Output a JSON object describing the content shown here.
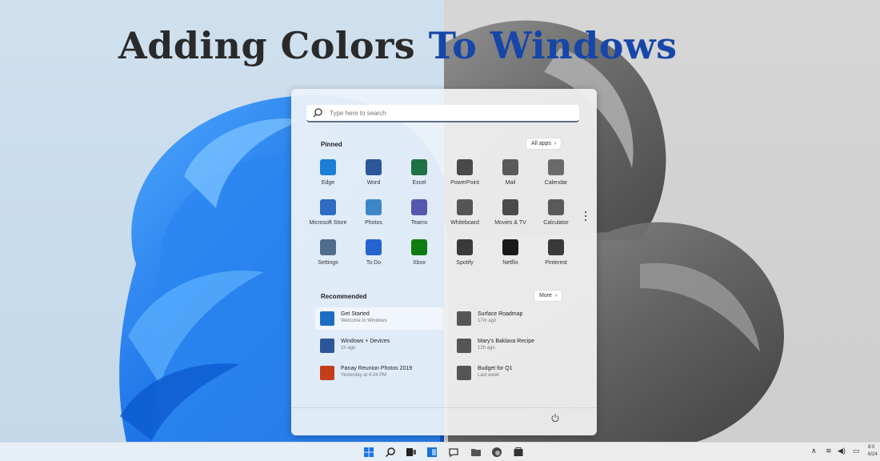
{
  "headline": {
    "part1": "Adding Colors",
    "part2": "To Windows"
  },
  "search": {
    "placeholder": "Type here to search"
  },
  "pinned": {
    "title": "Pinned",
    "all_apps_label": "All apps",
    "apps": [
      {
        "label": "Edge",
        "icon": "edge-icon",
        "color": "#1b7fd6"
      },
      {
        "label": "Word",
        "icon": "word-icon",
        "color": "#2b579a"
      },
      {
        "label": "Excel",
        "icon": "excel-icon",
        "color": "#1f7244"
      },
      {
        "label": "PowerPoint",
        "icon": "powerpoint-icon",
        "color": "#4a4a4a"
      },
      {
        "label": "Mail",
        "icon": "mail-icon",
        "color": "#5a5a5a"
      },
      {
        "label": "Calendar",
        "icon": "calendar-icon",
        "color": "#6a6a6a"
      },
      {
        "label": "Microsoft Store",
        "icon": "store-icon",
        "color": "#2d6cc0"
      },
      {
        "label": "Photos",
        "icon": "photos-icon",
        "color": "#3d87c7"
      },
      {
        "label": "Teams",
        "icon": "teams-icon",
        "color": "#5558af"
      },
      {
        "label": "Whiteboard",
        "icon": "whiteboard-icon",
        "color": "#555555"
      },
      {
        "label": "Movies & TV",
        "icon": "movies-icon",
        "color": "#4a4a4a"
      },
      {
        "label": "Calculator",
        "icon": "calculator-icon",
        "color": "#5a5a5a"
      },
      {
        "label": "Settings",
        "icon": "settings-icon",
        "color": "#4f6c8a"
      },
      {
        "label": "To Do",
        "icon": "todo-icon",
        "color": "#2564cf"
      },
      {
        "label": "Xbox",
        "icon": "xbox-icon",
        "color": "#107c10"
      },
      {
        "label": "Spotify",
        "icon": "spotify-icon",
        "color": "#3a3a3a"
      },
      {
        "label": "Netflix",
        "icon": "netflix-icon",
        "color": "#1a1a1a"
      },
      {
        "label": "Pinterest",
        "icon": "pinterest-icon",
        "color": "#3a3a3a"
      }
    ]
  },
  "recommended": {
    "title": "Recommended",
    "more_label": "More",
    "items": [
      {
        "title": "Get Started",
        "subtitle": "Welcome to Windows",
        "icon": "get-started-icon",
        "color": "#1b6ec2"
      },
      {
        "title": "Surface Roadmap",
        "subtitle": "17m ago",
        "icon": "pdf-icon",
        "color": "#555555"
      },
      {
        "title": "Windows + Devices",
        "subtitle": "1h ago",
        "icon": "word-doc-icon",
        "color": "#2b579a"
      },
      {
        "title": "Mary's Baklava Recipe",
        "subtitle": "12h ago",
        "icon": "pdf-icon",
        "color": "#555555"
      },
      {
        "title": "Panay Reunion Photos 2019",
        "subtitle": "Yesterday at 4:24 PM",
        "icon": "powerpoint-doc-icon",
        "color": "#c43e1c"
      },
      {
        "title": "Budget for Q1",
        "subtitle": "Last week",
        "icon": "excel-doc-icon",
        "color": "#555555"
      }
    ]
  },
  "tray": {
    "time": "8:0",
    "date": "6/24"
  },
  "colors": {
    "accent_blue": "#1646a8",
    "headline_dark": "#2a2a2a"
  }
}
